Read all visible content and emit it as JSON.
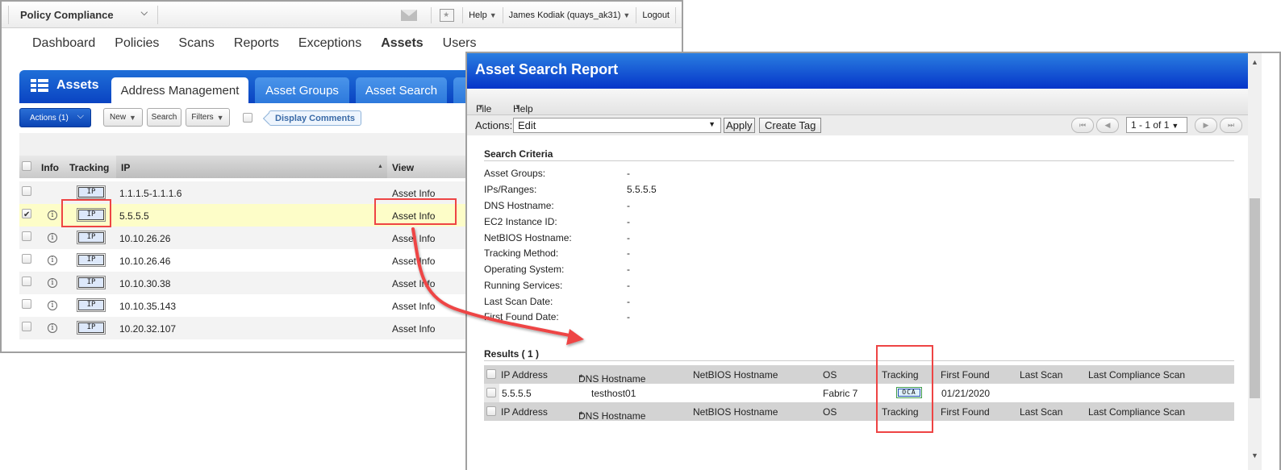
{
  "app": {
    "switcher_label": "Policy Compliance",
    "top_links": {
      "help": "Help",
      "user": "James Kodiak (quays_ak31)",
      "logout": "Logout"
    },
    "nav": [
      "Dashboard",
      "Policies",
      "Scans",
      "Reports",
      "Exceptions",
      "Assets",
      "Users"
    ],
    "nav_active": "Assets"
  },
  "assets_panel": {
    "title": "Assets",
    "tabs": [
      "Address Management",
      "Asset Groups",
      "Asset Search"
    ],
    "active_tab": "Address Management",
    "toolbar": {
      "actions_label": "Actions (1)",
      "new_label": "New",
      "search_label": "Search",
      "filters_label": "Filters",
      "display_comments_label": "Display Comments"
    },
    "columns": [
      "Info",
      "Tracking",
      "IP",
      "View"
    ],
    "rows": [
      {
        "checked": false,
        "info": false,
        "tracking": "IP",
        "ip": "1.1.1.5-1.1.1.6",
        "view": "Asset Info"
      },
      {
        "checked": true,
        "info": true,
        "tracking": "IP",
        "ip": "5.5.5.5",
        "view": "Asset Info"
      },
      {
        "checked": false,
        "info": true,
        "tracking": "IP",
        "ip": "10.10.26.26",
        "view": "Asset Info"
      },
      {
        "checked": false,
        "info": true,
        "tracking": "IP",
        "ip": "10.10.26.46",
        "view": "Asset Info"
      },
      {
        "checked": false,
        "info": true,
        "tracking": "IP",
        "ip": "10.10.30.38",
        "view": "Asset Info"
      },
      {
        "checked": false,
        "info": true,
        "tracking": "IP",
        "ip": "10.10.35.143",
        "view": "Asset Info"
      },
      {
        "checked": false,
        "info": true,
        "tracking": "IP",
        "ip": "10.20.32.107",
        "view": "Asset Info"
      }
    ]
  },
  "report": {
    "title": "Asset Search Report",
    "menu": {
      "file": "File",
      "help": "Help"
    },
    "actions_label": "Actions:",
    "actions_value": "Edit",
    "apply_label": "Apply",
    "create_tag_label": "Create Tag",
    "pager_label": "1 - 1 of 1",
    "search_criteria": {
      "heading": "Search Criteria",
      "items": [
        {
          "label": "Asset Groups:",
          "value": "-"
        },
        {
          "label": "IPs/Ranges:",
          "value": "5.5.5.5"
        },
        {
          "label": "DNS Hostname:",
          "value": "-"
        },
        {
          "label": "EC2 Instance ID:",
          "value": "-"
        },
        {
          "label": "NetBIOS Hostname:",
          "value": "-"
        },
        {
          "label": "Tracking Method:",
          "value": "-"
        },
        {
          "label": "Operating System:",
          "value": "-"
        },
        {
          "label": "Running Services:",
          "value": "-"
        },
        {
          "label": "Last Scan Date:",
          "value": "-"
        },
        {
          "label": "First Found Date:",
          "value": "-"
        }
      ]
    },
    "results": {
      "heading": "Results ( 1 )",
      "columns": [
        "IP Address",
        "DNS Hostname",
        "NetBIOS Hostname",
        "OS",
        "Tracking",
        "First Found",
        "Last Scan",
        "Last Compliance Scan"
      ],
      "rows": [
        {
          "ip": "5.5.5.5",
          "dns": "testhost01",
          "netbios": "",
          "os": "Fabric 7",
          "tracking": "OCA",
          "first_found": "01/21/2020",
          "last_scan": "",
          "last_compliance_scan": ""
        }
      ]
    }
  },
  "annotation": {
    "highlight_color": "#ee4444"
  }
}
